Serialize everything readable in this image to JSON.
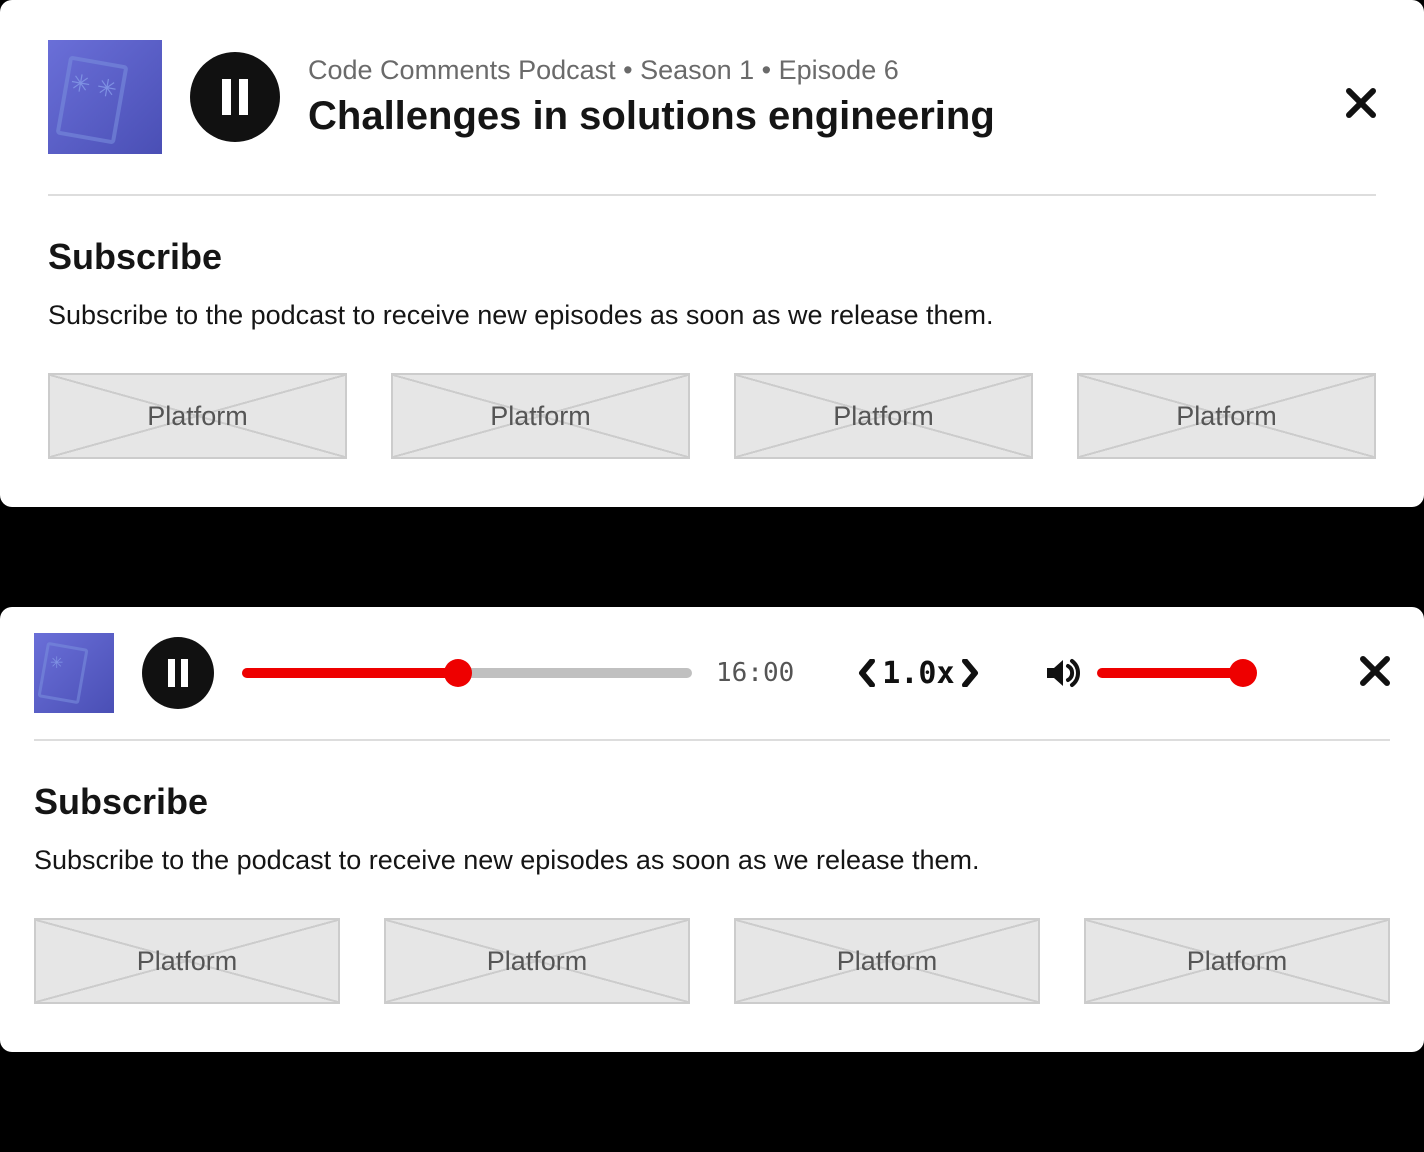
{
  "player1": {
    "breadcrumb": "Code Comments Podcast • Season 1 • Episode 6",
    "title": "Challenges in solutions engineering"
  },
  "subscribe": {
    "heading": "Subscribe",
    "description": "Subscribe to the podcast to receive new episodes as soon as we release them.",
    "platforms": [
      "Platform",
      "Platform",
      "Platform",
      "Platform"
    ]
  },
  "player2": {
    "time": "16:00",
    "speed": "1.0x",
    "progress_percent": 48,
    "volume_percent": 100
  },
  "colors": {
    "accent": "#ee0000",
    "text": "#151515",
    "muted": "#6a6a6a"
  }
}
